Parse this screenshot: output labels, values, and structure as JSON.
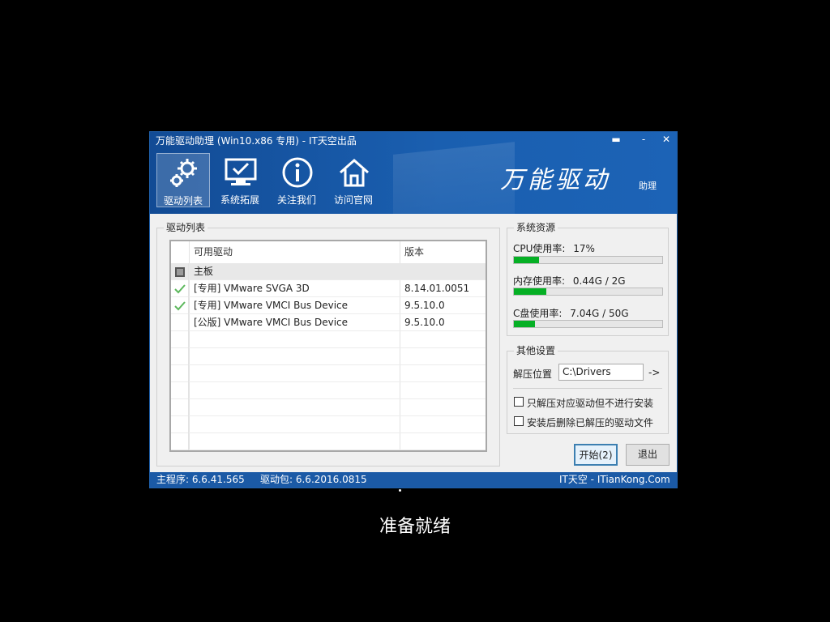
{
  "window": {
    "title": "万能驱动助理 (Win10.x86 专用) - IT天空出品",
    "controls": {
      "pin": "▬",
      "minimize": "-",
      "close": "✕"
    }
  },
  "toolbar": [
    {
      "label": "驱动列表",
      "icon": "gears-icon",
      "active": true
    },
    {
      "label": "系统拓展",
      "icon": "monitor-check-icon",
      "active": false
    },
    {
      "label": "关注我们",
      "icon": "info-icon",
      "active": false
    },
    {
      "label": "访问官网",
      "icon": "home-icon",
      "active": false
    }
  ],
  "brand": {
    "logo_text": "万能驱动",
    "sub": "助理"
  },
  "driver_list": {
    "group_title": "驱动列表",
    "columns": [
      "可用驱动",
      "版本"
    ],
    "rows": [
      {
        "icon": "chip-icon",
        "name": "主板",
        "version": "",
        "checked": false
      },
      {
        "icon": "check-icon",
        "name": "[专用] VMware SVGA 3D",
        "version": "8.14.01.0051",
        "checked": true
      },
      {
        "icon": "check-icon",
        "name": "[专用] VMware VMCI Bus Device",
        "version": "9.5.10.0",
        "checked": true
      },
      {
        "icon": "",
        "name": "[公版] VMware VMCI Bus Device",
        "version": "9.5.10.0",
        "checked": false
      }
    ]
  },
  "system_resources": {
    "group_title": "系统资源",
    "items": [
      {
        "label": "CPU使用率:",
        "value": "17%",
        "fraction": 0.17
      },
      {
        "label": "内存使用率:",
        "value": "0.44G / 2G",
        "fraction": 0.22
      },
      {
        "label": "C盘使用率:",
        "value": "7.04G / 50G",
        "fraction": 0.14
      }
    ],
    "bar_color": "#06b025"
  },
  "other_settings": {
    "group_title": "其他设置",
    "extract_label": "解压位置",
    "extract_path": "C:\\Drivers",
    "browse": "->",
    "options": [
      {
        "label": "只解压对应驱动但不进行安装",
        "checked": false
      },
      {
        "label": "安装后删除已解压的驱动文件",
        "checked": false
      }
    ]
  },
  "buttons": {
    "start": "开始(2)",
    "exit": "退出"
  },
  "status": {
    "main_program": "主程序: 6.6.41.565",
    "driver_pack": "驱动包: 6.6.2016.0815",
    "site": "IT天空 - ITianKong.Com"
  },
  "overlay": {
    "message": "准备就绪"
  },
  "colors": {
    "header": "#1a5fb0",
    "statusbar": "#1b5aa6",
    "background": "#000000"
  }
}
